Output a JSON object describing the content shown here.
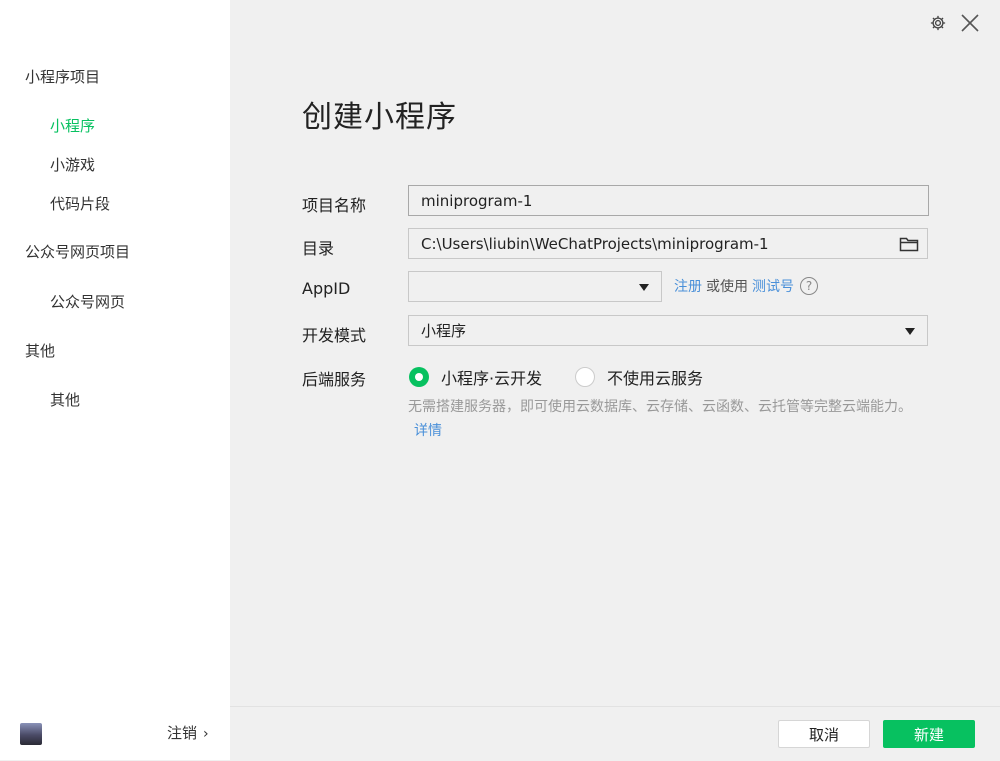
{
  "sidebar": {
    "groups": [
      {
        "label": "小程序项目",
        "items": [
          {
            "label": "小程序"
          },
          {
            "label": "小游戏"
          },
          {
            "label": "代码片段"
          }
        ]
      },
      {
        "label": "公众号网页项目",
        "items": [
          {
            "label": "公众号网页"
          }
        ]
      },
      {
        "label": "其他",
        "items": [
          {
            "label": "其他"
          }
        ]
      }
    ],
    "active_item": "小程序",
    "logout_label": "注销"
  },
  "window": {
    "settings_icon": "gear-icon",
    "close_icon": "close-icon"
  },
  "main": {
    "title": "创建小程序",
    "form": {
      "project_name": {
        "label": "项目名称",
        "value": "miniprogram-1"
      },
      "directory": {
        "label": "目录",
        "value": "C:\\Users\\liubin\\WeChatProjects\\miniprogram-1"
      },
      "appid": {
        "label": "AppID",
        "value": "",
        "register_link": "注册",
        "or_use": "或使用",
        "test_link": "测试号",
        "help": "?"
      },
      "dev_mode": {
        "label": "开发模式",
        "value": "小程序"
      },
      "backend": {
        "label": "后端服务",
        "options": [
          {
            "label": "小程序·云开发",
            "selected": true
          },
          {
            "label": "不使用云服务",
            "selected": false
          }
        ],
        "description": "无需搭建服务器，即可使用云数据库、云存储、云函数、云托管等完整云端能力。",
        "detail_link": "详情"
      }
    }
  },
  "footer": {
    "cancel_label": "取消",
    "create_label": "新建"
  },
  "colors": {
    "accent": "#07c160",
    "link": "#4a90d9"
  }
}
